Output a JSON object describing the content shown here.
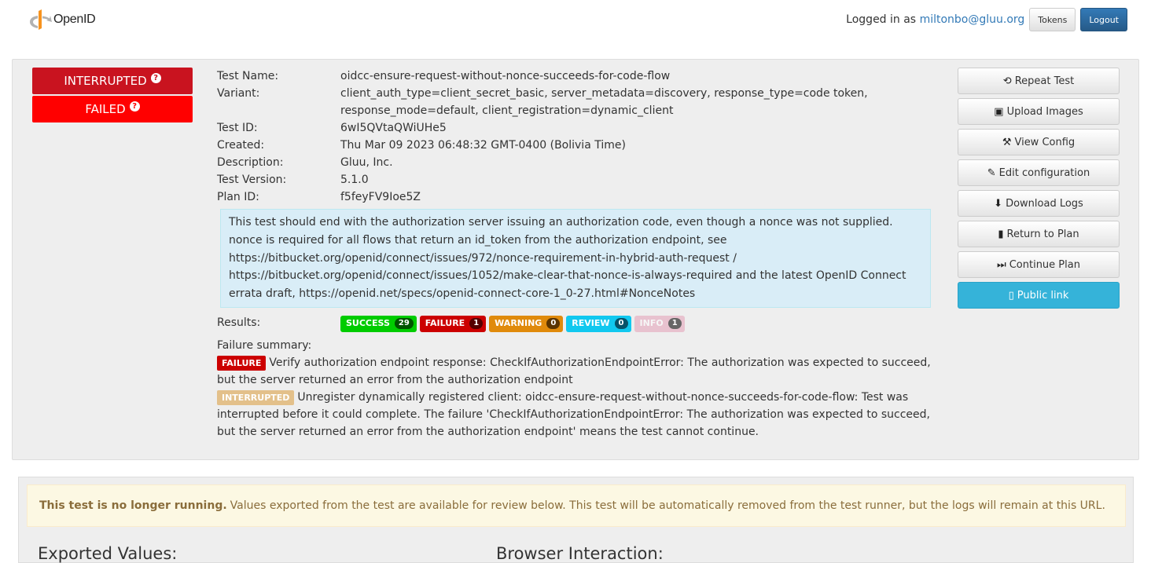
{
  "header": {
    "logo_text": "OpenID",
    "logged_prefix": "Logged in as",
    "user_email": "miltonbo@gluu.org",
    "tokens_label": "Tokens",
    "logout_label": "Logout"
  },
  "status": {
    "interrupted": "INTERRUPTED",
    "failed": "FAILED",
    "help_glyph": "?"
  },
  "test": {
    "labels": {
      "name": "Test Name:",
      "variant": "Variant:",
      "id": "Test ID:",
      "created": "Created:",
      "description": "Description:",
      "version": "Test Version:",
      "plan_id": "Plan ID:"
    },
    "name": "oidcc-ensure-request-without-nonce-succeeds-for-code-flow",
    "variant": "client_auth_type=client_secret_basic, server_metadata=discovery, response_type=code token, response_mode=default, client_registration=dynamic_client",
    "id": "6wI5QVtaQWiUHe5",
    "created": "Thu Mar 09 2023 06:48:32 GMT-0400 (Bolivia Time)",
    "description": "Gluu, Inc.",
    "version": "5.1.0",
    "plan_id": "f5feyFV9Ioe5Z",
    "long_description": "This test should end with the authorization server issuing an authorization code, even though a nonce was not supplied. nonce is required for all flows that return an id_token from the authorization endpoint, see https://bitbucket.org/openid/connect/issues/972/nonce-requirement-in-hybrid-auth-request / https://bitbucket.org/openid/connect/issues/1052/make-clear-that-nonce-is-always-required and the latest OpenID Connect errata draft, https://openid.net/specs/openid-connect-core-1_0-27.html#NonceNotes"
  },
  "results": {
    "label": "Results:",
    "success_label": "SUCCESS",
    "success_count": "29",
    "failure_label": "FAILURE",
    "failure_count": "1",
    "warning_label": "WARNING",
    "warning_count": "0",
    "review_label": "REVIEW",
    "review_count": "0",
    "info_label": "INFO",
    "info_count": "1"
  },
  "failure_summary": {
    "label": "Failure summary:",
    "items": [
      {
        "tag": "FAILURE",
        "text": "Verify authorization endpoint response: CheckIfAuthorizationEndpointError: The authorization was expected to succeed, but the server returned an error from the authorization endpoint"
      },
      {
        "tag": "INTERRUPTED",
        "text": "Unregister dynamically registered client: oidcc-ensure-request-without-nonce-succeeds-for-code-flow: Test was interrupted before it could complete. The failure 'CheckIfAuthorizationEndpointError: The authorization was expected to succeed, but the server returned an error from the authorization endpoint' means the test cannot continue."
      }
    ]
  },
  "actions": {
    "repeat": "Repeat Test",
    "upload": "Upload Images",
    "view_config": "View Config",
    "edit_config": "Edit configuration",
    "download_logs": "Download Logs",
    "return_plan": "Return to Plan",
    "continue_plan": "Continue Plan",
    "public_link": "Public link"
  },
  "notice": {
    "bold": "This test is no longer running.",
    "text": "Values exported from the test are available for review below. This test will be automatically removed from the test runner, but the logs will remain at this URL."
  },
  "sections": {
    "exported": "Exported Values:",
    "browser": "Browser Interaction:"
  }
}
